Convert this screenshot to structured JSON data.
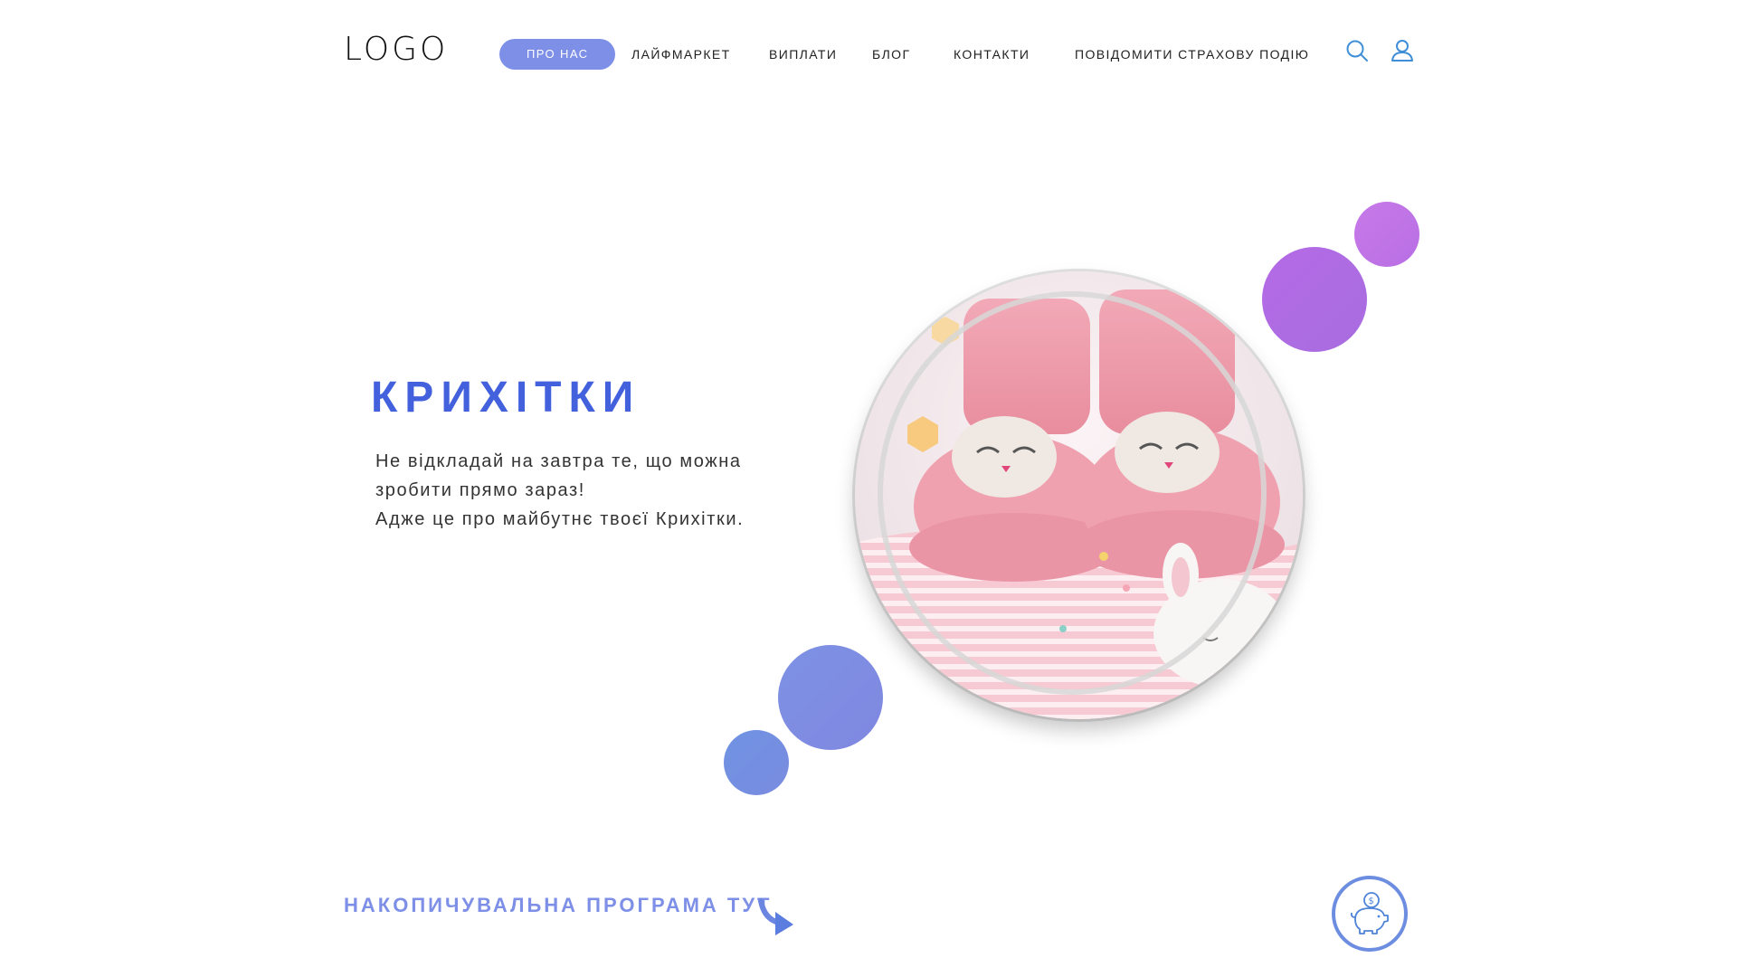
{
  "header": {
    "logo": "LOGO",
    "nav": [
      {
        "label": "ПРО НАС",
        "active": true
      },
      {
        "label": "ЛАЙФМАРКЕТ",
        "active": false
      },
      {
        "label": "ВИПЛАТИ",
        "active": false
      },
      {
        "label": "БЛОГ",
        "active": false
      },
      {
        "label": "КОНТАКТИ",
        "active": false
      },
      {
        "label": "ПОВІДОМИТИ СТРАХОВУ ПОДІЮ",
        "active": false
      }
    ],
    "icons": [
      "search-icon",
      "user-icon"
    ]
  },
  "hero": {
    "title": "КРИХІТКИ",
    "lines": [
      "Не відкладай на завтра те, що можна",
      "зробити прямо зараз!",
      "Адже це про майбутнє твоєї Крихітки."
    ]
  },
  "footer": {
    "savings_link": "НАКОПИЧУВАЛЬНА ПРОГРАМА ТУТ",
    "arrow_icon": "curved-arrow-down-icon",
    "piggy_icon": "piggy-bank-icon"
  },
  "colors": {
    "accent": "#4361dd",
    "nav_active": "#7d8fe6",
    "dot_purple": "#c274e6",
    "dot_violet": "#b06ae4",
    "dot_blue": "#7f8fe2"
  }
}
